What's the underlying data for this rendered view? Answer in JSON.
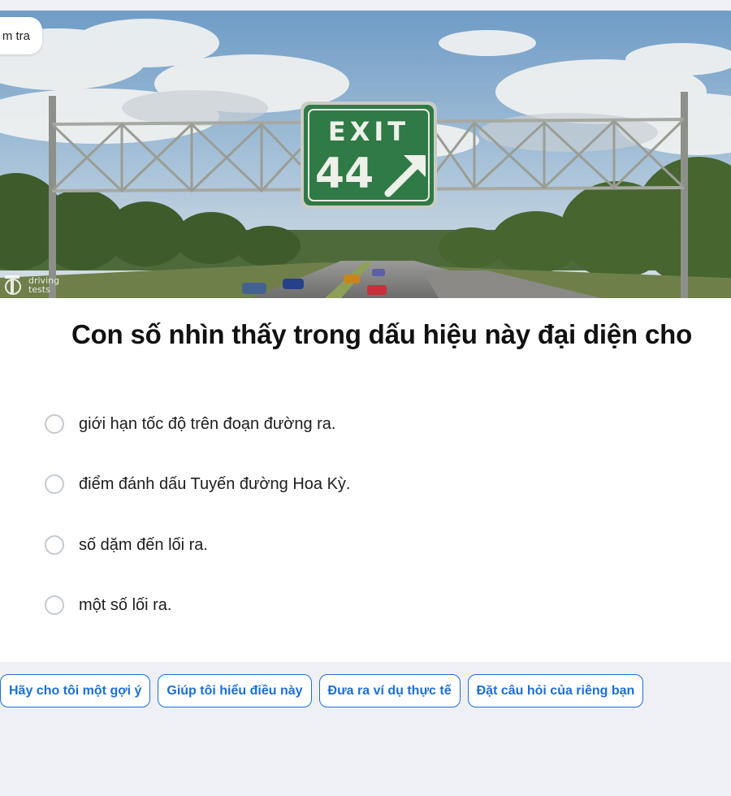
{
  "tab": {
    "label": "m tra"
  },
  "image": {
    "sign_top": "EXIT",
    "sign_number": "44",
    "watermark_line1": "driving",
    "watermark_line2": "tests"
  },
  "question": {
    "text": "Con số nhìn thấy trong dấu hiệu này đại diện cho"
  },
  "options": [
    {
      "label": "giới hạn tốc độ trên đoạn đường ra.",
      "selected": false
    },
    {
      "label": "điểm đánh dấu Tuyến đường Hoa Kỳ.",
      "selected": false
    },
    {
      "label": "số dặm đến lối ra.",
      "selected": false
    },
    {
      "label": "một số lối ra.",
      "selected": false
    }
  ],
  "actions": [
    {
      "label": "Hãy cho tôi một gợi ý"
    },
    {
      "label": "Giúp tôi hiểu điều này"
    },
    {
      "label": "Đưa ra ví dụ thực tế"
    },
    {
      "label": "Đặt câu hỏi của riêng bạn"
    }
  ],
  "colors": {
    "accent": "#1b6fd6",
    "page_bg": "#eff0f6",
    "sign_green": "#2f7a45"
  }
}
